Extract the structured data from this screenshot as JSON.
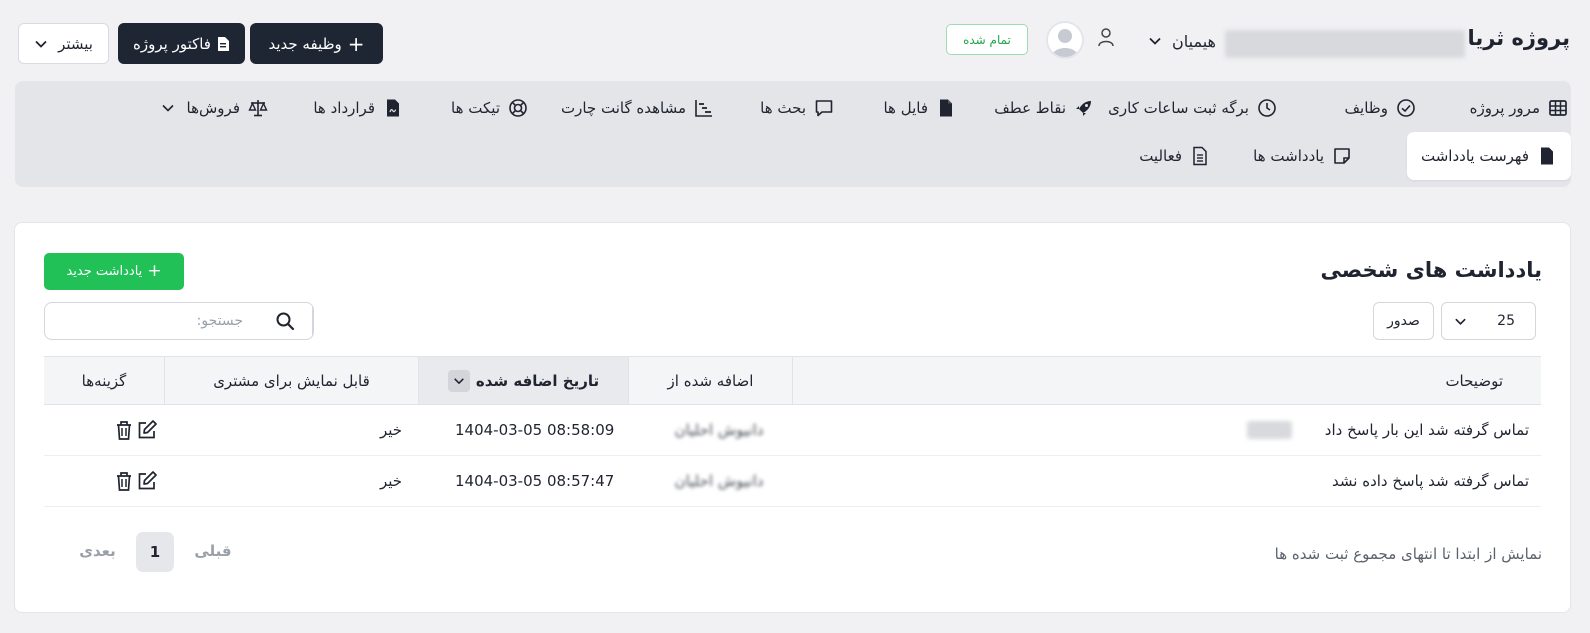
{
  "header": {
    "project_title": "پروژه ثریا",
    "client_name": "هیمیان",
    "status_badge": "تمام شده",
    "new_task_label": "وظیفه جدید",
    "invoice_label": "فاکتور پروژه",
    "more_label": "بیشتر"
  },
  "tabs": {
    "row1": [
      {
        "label": "مرور پروژه",
        "icon": "grid-icon"
      },
      {
        "label": "وظایف",
        "icon": "check-circle-icon"
      },
      {
        "label": "برگه ثبت ساعات کاری",
        "icon": "clock-icon"
      },
      {
        "label": "نقاط عطف",
        "icon": "rocket-icon"
      },
      {
        "label": "فایل ها",
        "icon": "file-icon"
      },
      {
        "label": "بحث ها",
        "icon": "chat-icon"
      },
      {
        "label": "مشاهده گانت چارت",
        "icon": "gantt-icon"
      },
      {
        "label": "تیکت ها",
        "icon": "lifebuoy-icon"
      },
      {
        "label": "قرارداد ها",
        "icon": "contract-icon"
      },
      {
        "label": "فروش‌ها",
        "icon": "scale-icon"
      }
    ],
    "row2": [
      {
        "label": "فهرست یادداشت",
        "icon": "file-icon",
        "active": true
      },
      {
        "label": "یادداشت ها",
        "icon": "sticky-note-icon"
      },
      {
        "label": "فعالیت",
        "icon": "document-icon"
      }
    ]
  },
  "notes": {
    "title": "یادداشت های شخصی",
    "new_note_label": "یادداشت جدید",
    "search_placeholder": "جستجو:",
    "page_length": "25",
    "export_label": "صدور",
    "columns": {
      "description": "توضیحات",
      "added_by": "اضافه شده از",
      "date_added": "تاریخ اضافه شده",
      "visible_to_customer": "قابل نمایش برای مشتری",
      "options": "گزینه‌ها"
    },
    "rows": [
      {
        "description": "تماس گرفته شد این بار پاسخ داد",
        "added_by": "دانیوش احلیان",
        "date": "1404-03-05 08:58:09",
        "visible": "خیر"
      },
      {
        "description": "تماس گرفته شد پاسخ داده نشد",
        "added_by": "دانیوش احلیان",
        "date": "1404-03-05 08:57:47",
        "visible": "خیر"
      }
    ],
    "info_text": "نمایش از ابتدا تا انتهای مجموع ثبت شده ها",
    "pager": {
      "prev": "قبلی",
      "current": "1",
      "next": "بعدی"
    }
  },
  "colors": {
    "accent_dark": "#1f2633",
    "success": "#22c158"
  }
}
